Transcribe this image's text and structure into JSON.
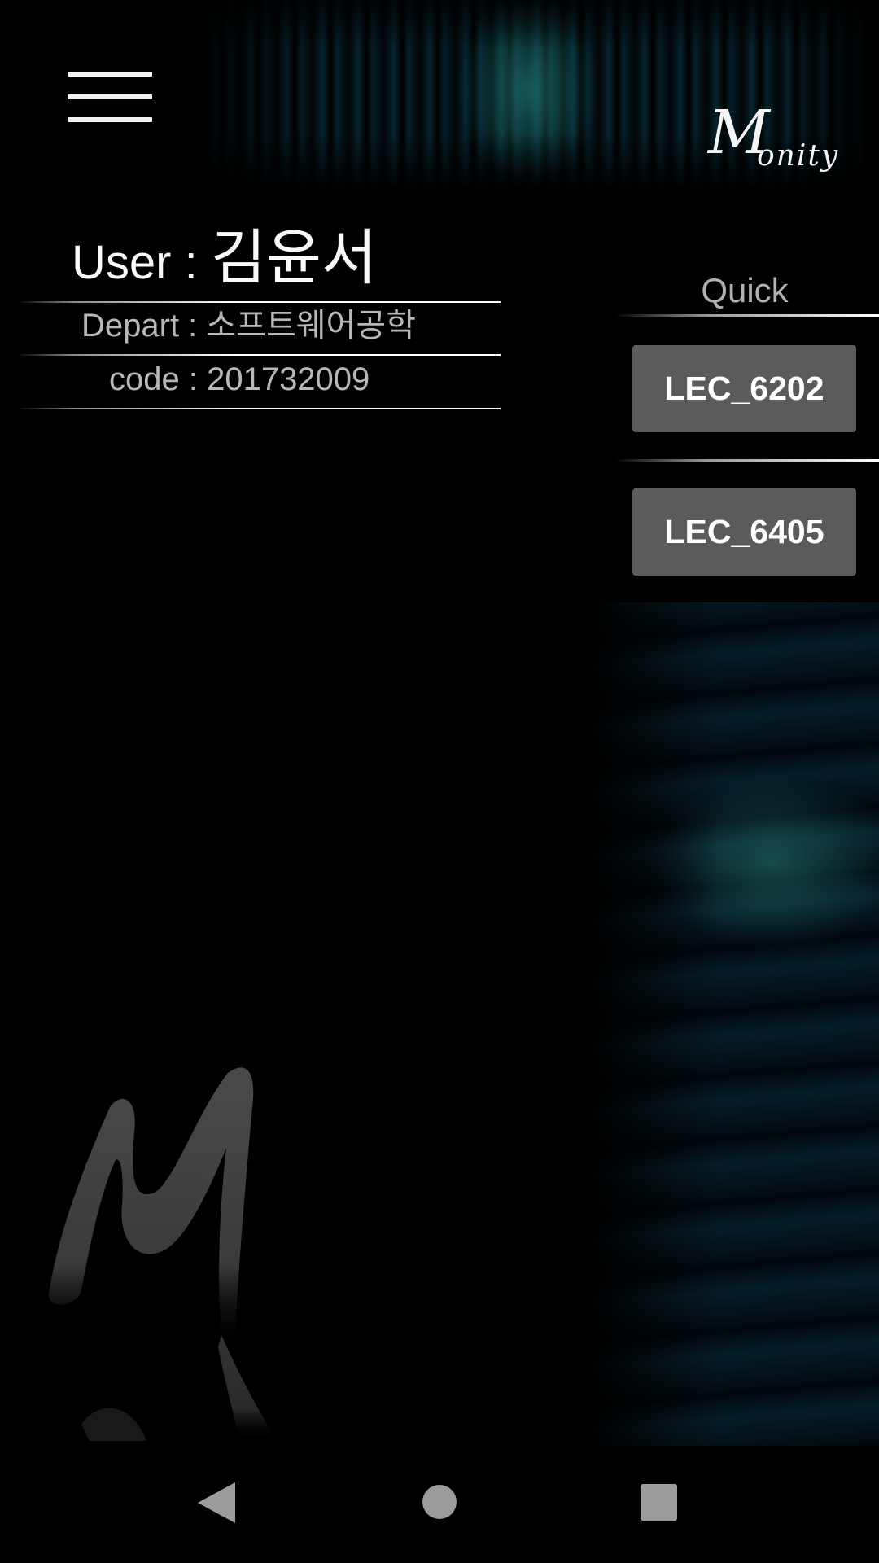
{
  "header": {
    "menu_icon": "hamburger-menu-icon",
    "logo_big_letter": "M",
    "logo_rest": "onity"
  },
  "user": {
    "user_prefix": "User : ",
    "user_name": "김윤서",
    "depart_text": "Depart : 소프트웨어공학",
    "code_text": "code : 201732009"
  },
  "quick": {
    "title": "Quick",
    "buttons": [
      {
        "label": "LEC_6202"
      },
      {
        "label": "LEC_6405"
      }
    ]
  },
  "nav": {
    "back_icon": "back-triangle-icon",
    "home_icon": "home-circle-icon",
    "recent_icon": "recent-apps-square-icon"
  },
  "colors": {
    "background": "#000000",
    "button_bg": "#5b5b5d",
    "secondary_text": "#b8b8b8",
    "accent_teal": "#2a8a86"
  }
}
